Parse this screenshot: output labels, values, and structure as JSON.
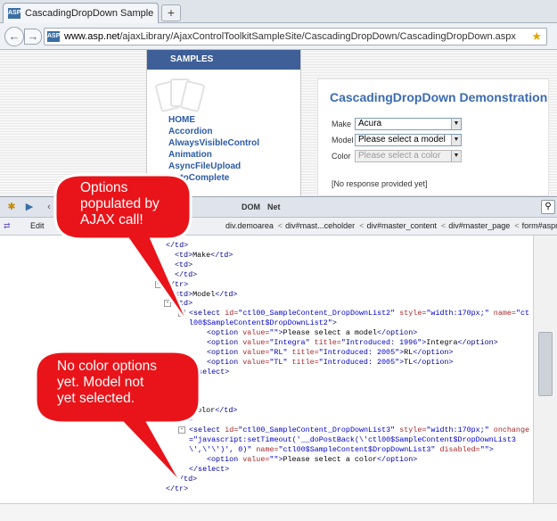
{
  "browser": {
    "tab_title": "CascadingDropDown Sample",
    "new_tab_symbol": "+",
    "url_host": "www.asp.net",
    "url_path": "/ajaxLibrary/AjaxControlToolkitSampleSite/CascadingDropDown/CascadingDropDown.aspx",
    "favicon_label": "ASP"
  },
  "samples": {
    "heading": "SAMPLES",
    "links": [
      "HOME",
      "Accordion",
      "AlwaysVisibleControl",
      "Animation",
      "AsyncFileUpload",
      "AutoComplete"
    ]
  },
  "demo": {
    "title": "CascadingDropDown Demonstration",
    "make_label": "Make",
    "make_value": "Acura",
    "model_label": "Model",
    "model_value": "Please select a model",
    "color_label": "Color",
    "color_value": "Please select a color",
    "response": "[No response provided yet]"
  },
  "firebug": {
    "tabs": [
      "DOM",
      "Net"
    ],
    "edit_label": "Edit",
    "breadcrumbs": [
      "div.demoarea",
      "div#mast...ceholder",
      "div#master_content",
      "div#master_page",
      "form#aspnet"
    ],
    "code_lines": [
      {
        "indent": 0,
        "html": "<span class='tg'>&lt;/td&gt;</span>"
      },
      {
        "indent": 1,
        "html": "<span class='tg'>&lt;td&gt;</span><span class='tx'>Make</span><span class='tg'>&lt;/td&gt;</span>"
      },
      {
        "indent": 1,
        "html": "<span class='tg'>&lt;td&gt;</span>"
      },
      {
        "indent": 1,
        "html": "<span class='tg'>&lt;/td&gt;</span>"
      },
      {
        "indent": 0,
        "html": "<span class='tg'>&lt;/tr&gt;</span>",
        "toggle": "+"
      },
      {
        "indent": 1,
        "html": "<span class='tg'>&lt;td&gt;</span><span class='tx'>Model</span><span class='tg'>&lt;/td&gt;</span>"
      },
      {
        "indent": 1,
        "html": "<span class='tg'>&lt;td&gt;</span>",
        "toggle": "-"
      },
      {
        "indent": 2,
        "html": "<span class='tg'>&lt;select </span><span class='an'>id=</span><span class='av'>\"ctl00_SampleContent_DropDownList2\"</span><span class='an'> style=</span><span class='av'>\"width:170px;\"</span><span class='an'> name=</span><span class='av'>\"ct</span>",
        "toggle": "-"
      },
      {
        "indent": 2,
        "html": "<span class='av'>l00$SampleContent$DropDownList2\"</span><span class='tg'>&gt;</span>"
      },
      {
        "indent": 3,
        "html": "<span class='tg'>&lt;option </span><span class='an'>value=</span><span class='av'>\"\"</span><span class='tg'>&gt;</span><span class='tx'>Please select a model</span><span class='tg'>&lt;/option&gt;</span>"
      },
      {
        "indent": 3,
        "html": "<span class='tg'>&lt;option </span><span class='an'>value=</span><span class='av'>\"Integra\"</span><span class='an'> title=</span><span class='av'>\"Introduced: 1996\"</span><span class='tg'>&gt;</span><span class='tx'>Integra</span><span class='tg'>&lt;/option&gt;</span>"
      },
      {
        "indent": 3,
        "html": "<span class='tg'>&lt;option </span><span class='an'>value=</span><span class='av'>\"RL\"</span><span class='an'> title=</span><span class='av'>\"Introduced: 2005\"</span><span class='tg'>&gt;</span><span class='tx'>RL</span><span class='tg'>&lt;/option&gt;</span>"
      },
      {
        "indent": 3,
        "html": "<span class='tg'>&lt;option </span><span class='an'>value=</span><span class='av'>\"TL\"</span><span class='an'> title=</span><span class='av'>\"Introduced: 2005\"</span><span class='tg'>&gt;</span><span class='tx'>TL</span><span class='tg'>&lt;/option&gt;</span>"
      },
      {
        "indent": 2,
        "html": "<span class='tg'>&lt;/select&gt;</span>"
      },
      {
        "indent": 1,
        "html": "<span class='tg'>&lt;/td&gt;</span>"
      },
      {
        "indent": 0,
        "html": ""
      },
      {
        "indent": 0,
        "html": ""
      },
      {
        "indent": 1,
        "html": "<span class='tg'>&lt;td&gt;</span><span class='tx'>Color</span><span class='tg'>&lt;/td&gt;</span>"
      },
      {
        "indent": 1,
        "html": "<span class='tg'>&lt;td&gt;</span>",
        "toggle": "-"
      },
      {
        "indent": 2,
        "html": "<span class='tg'>&lt;select </span><span class='an'>id=</span><span class='av'>\"ctl00_SampleContent_DropDownList3\"</span><span class='an'> style=</span><span class='av'>\"width:170px;\"</span><span class='an'> onchange</span>",
        "toggle": "-"
      },
      {
        "indent": 2,
        "html": "<span class='av'>=\"javascript:setTimeout('__doPostBack(\\'ctl00$SampleContent$DropDownList3</span>"
      },
      {
        "indent": 2,
        "html": "<span class='av'>\\',\\'\\')', 0)\"</span><span class='an'> name=</span><span class='av'>\"ctl00$SampleContent$DropDownList3\"</span><span class='an'> disabled=</span><span class='av'>\"\"</span><span class='tg'>&gt;</span>"
      },
      {
        "indent": 3,
        "html": "<span class='tg'>&lt;option </span><span class='an'>value=</span><span class='av'>\"\"</span><span class='tg'>&gt;</span><span class='tx'>Please select a color</span><span class='tg'>&lt;/option&gt;</span>"
      },
      {
        "indent": 2,
        "html": "<span class='tg'>&lt;/select&gt;</span>"
      },
      {
        "indent": 1,
        "html": "<span class='tg'>&lt;/td&gt;</span>"
      },
      {
        "indent": 0,
        "html": "<span class='tg'>&lt;/tr&gt;</span>"
      }
    ]
  },
  "callouts": {
    "top": "Options\npopulated by\nAJAX call!",
    "bottom": "No color options\nyet. Model not\nyet selected."
  },
  "colors": {
    "callout_fill": "#e8141a",
    "callout_stroke": "#ffffff",
    "samples_header": "#3e5f97",
    "demo_title": "#3b6bb0",
    "link": "#2a5aa8"
  }
}
